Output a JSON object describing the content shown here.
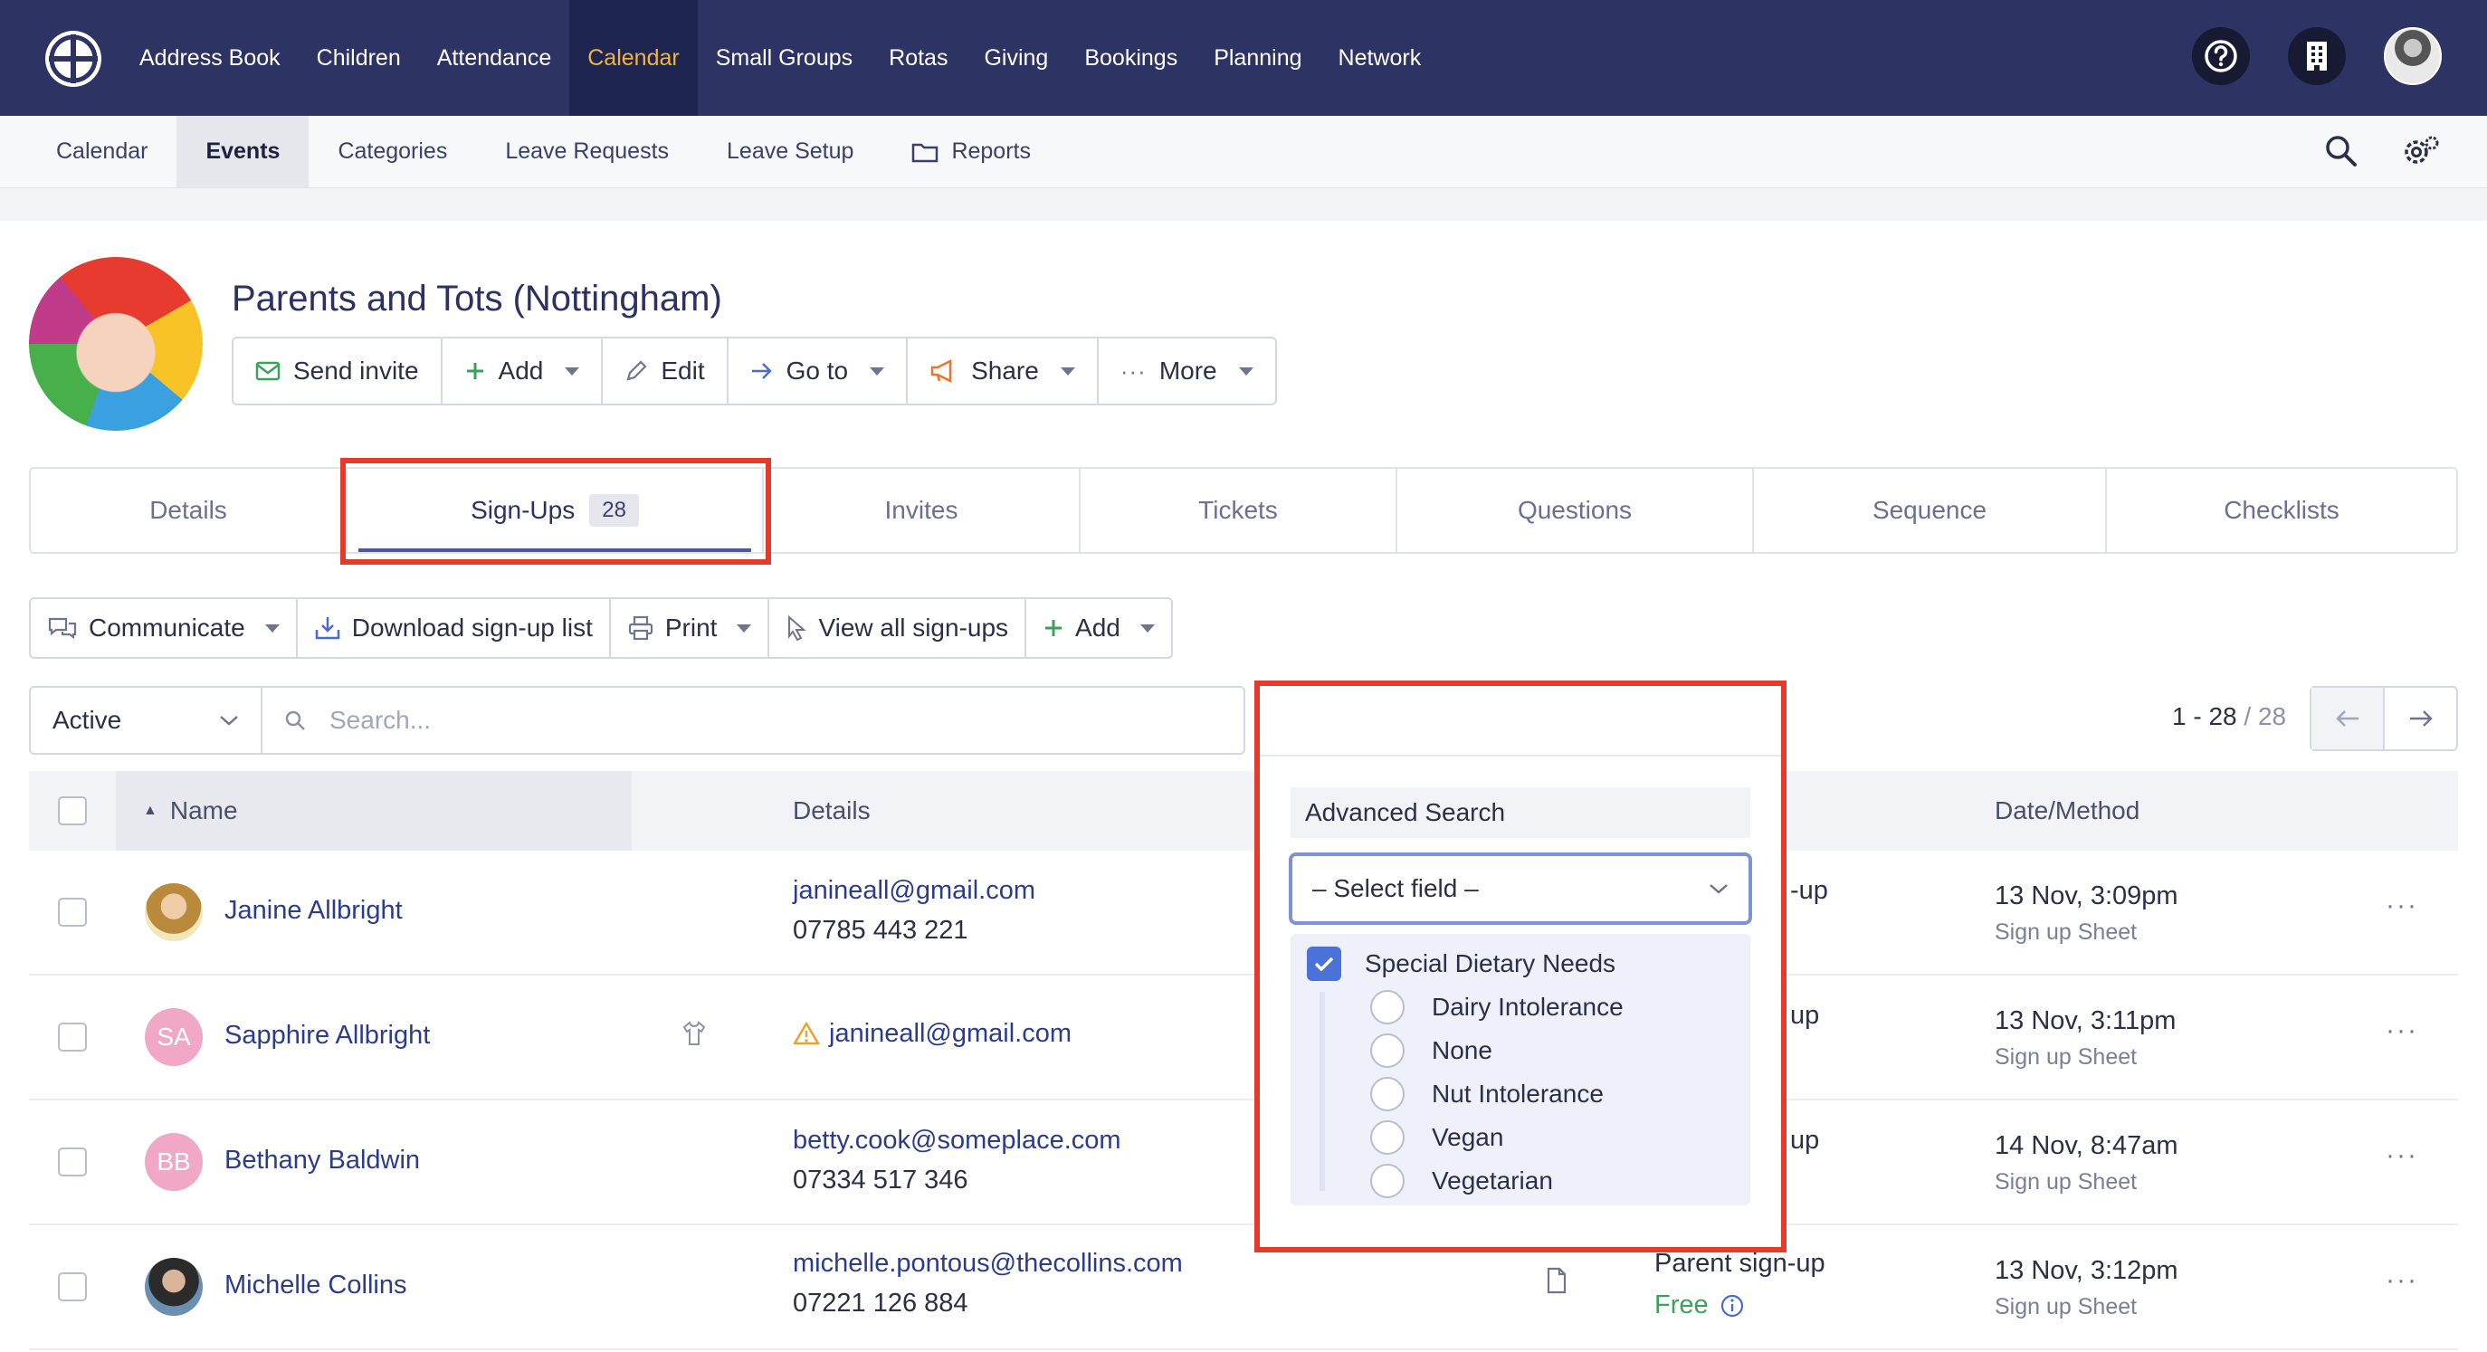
{
  "topnav": {
    "items": [
      "Address Book",
      "Children",
      "Attendance",
      "Calendar",
      "Small Groups",
      "Rotas",
      "Giving",
      "Bookings",
      "Planning",
      "Network"
    ],
    "active_index": 3
  },
  "subnav": {
    "items": [
      "Calendar",
      "Events",
      "Categories",
      "Leave Requests",
      "Leave Setup",
      "Reports"
    ],
    "active_index": 1
  },
  "event": {
    "title": "Parents and Tots (Nottingham)"
  },
  "actions": {
    "send_invite": "Send invite",
    "add": "Add",
    "edit": "Edit",
    "goto": "Go to",
    "share": "Share",
    "more": "More"
  },
  "tabs": [
    {
      "label": "Details"
    },
    {
      "label": "Sign-Ups",
      "badge": "28"
    },
    {
      "label": "Invites"
    },
    {
      "label": "Tickets"
    },
    {
      "label": "Questions"
    },
    {
      "label": "Sequence"
    },
    {
      "label": "Checklists"
    }
  ],
  "toolbar": {
    "communicate": "Communicate",
    "download": "Download sign-up list",
    "print": "Print",
    "view_all": "View all sign-ups",
    "add": "Add"
  },
  "filters": {
    "status": "Active",
    "search_placeholder": "Search..."
  },
  "pager": {
    "range": "1 - 28",
    "total": "/ 28"
  },
  "table": {
    "headers": {
      "name": "Name",
      "details": "Details",
      "date_method": "Date/Method"
    },
    "rows": [
      {
        "name": "Janine Allbright",
        "email": "janineall@gmail.com",
        "phone": "07785 443 221",
        "type_suffix": "-up",
        "date": "13 Nov, 3:09pm",
        "method": "Sign up Sheet"
      },
      {
        "name": "Sapphire Allbright",
        "initials": "SA",
        "email": "janineall@gmail.com",
        "type_suffix": "up",
        "date": "13 Nov, 3:11pm",
        "method": "Sign up Sheet"
      },
      {
        "name": "Bethany Baldwin",
        "initials": "BB",
        "email": "betty.cook@someplace.com",
        "phone": "07334 517 346",
        "type_suffix": "up",
        "date": "14 Nov, 8:47am",
        "method": "Sign up Sheet"
      },
      {
        "name": "Michelle Collins",
        "email": "michelle.pontous@thecollins.com",
        "phone": "07221 126 884",
        "type": "Parent sign-up",
        "price": "Free",
        "date": "13 Nov, 3:12pm",
        "method": "Sign up Sheet"
      }
    ]
  },
  "advanced_search": {
    "title": "Advanced Search",
    "select_placeholder": "– Select field –",
    "field_label": "Special Dietary Needs",
    "options": [
      "Dairy Intolerance",
      "None",
      "Nut Intolerance",
      "Vegan",
      "Vegetarian"
    ]
  },
  "colors": {
    "nav_bg": "#2d3363",
    "nav_active": "#f1b440",
    "highlight_red": "#e33a2c",
    "link": "#2c3c8c"
  }
}
